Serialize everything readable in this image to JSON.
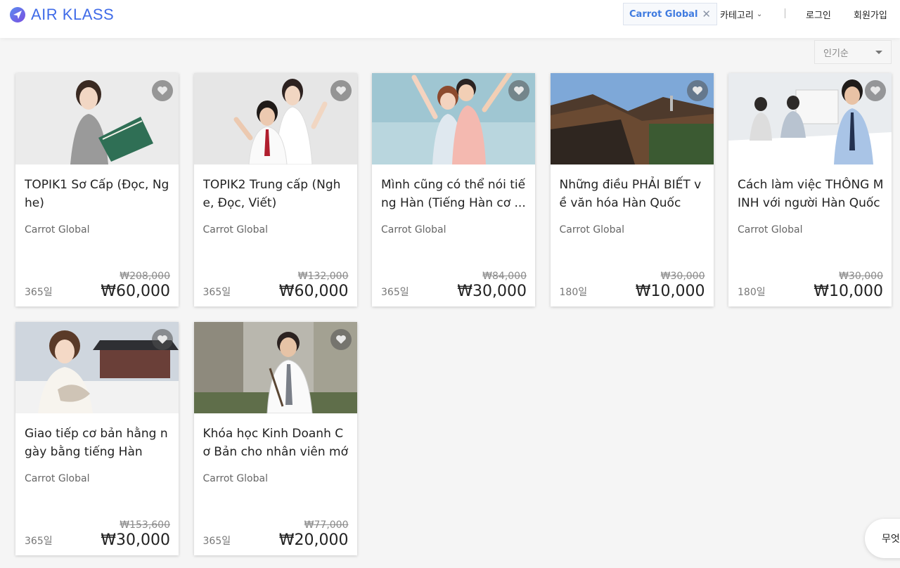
{
  "header": {
    "logo_text": "AIR KLASS",
    "filter_chip": "Carrot Global",
    "category_label": "카테고리",
    "login_label": "로그인",
    "signup_label": "회원가입"
  },
  "sort": {
    "selected": "인기순"
  },
  "courses": [
    {
      "title": "TOPIK1 Sơ Cấp (Đọc, Nghe)",
      "provider": "Carrot Global",
      "old_price": "₩208,000",
      "price": "₩60,000",
      "days": "365일"
    },
    {
      "title": "TOPIK2 Trung cấp (Nghe, Đọc, Viết)",
      "provider": "Carrot Global",
      "old_price": "₩132,000",
      "price": "₩60,000",
      "days": "365일"
    },
    {
      "title": "Mình cũng có thể nói tiếng Hàn (Tiếng Hàn cơ ...",
      "provider": "Carrot Global",
      "old_price": "₩84,000",
      "price": "₩30,000",
      "days": "365일"
    },
    {
      "title": "Những điều PHẢI BIẾT về văn hóa Hàn Quốc",
      "provider": "Carrot Global",
      "old_price": "₩30,000",
      "price": "₩10,000",
      "days": "180일"
    },
    {
      "title": "Cách làm việc THÔNG MINH với người Hàn Quốc",
      "provider": "Carrot Global",
      "old_price": "₩30,000",
      "price": "₩10,000",
      "days": "180일"
    },
    {
      "title": "Giao tiếp cơ bản hằng ngày bằng tiếng Hàn",
      "provider": "Carrot Global",
      "old_price": "₩153,600",
      "price": "₩30,000",
      "days": "365일"
    },
    {
      "title": "Khóa học Kinh Doanh Cơ Bản cho nhân viên mới",
      "provider": "Carrot Global",
      "old_price": "₩77,000",
      "price": "₩20,000",
      "days": "365일"
    }
  ],
  "float_button": {
    "label": "무엇"
  },
  "colors": {
    "brand": "#3f6be8",
    "chip_text": "#3f7be0"
  }
}
